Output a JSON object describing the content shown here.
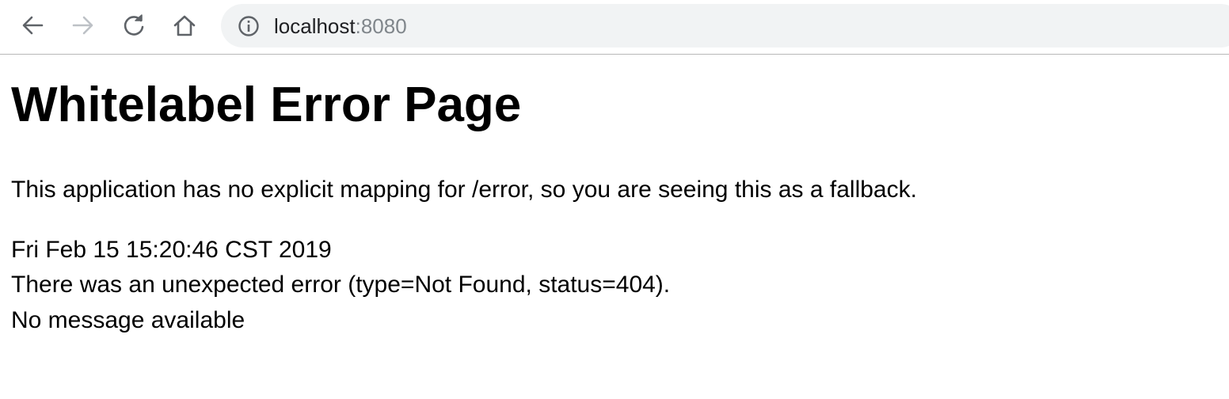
{
  "browser": {
    "address_bar": {
      "host": "localhost",
      "port": ":8080"
    },
    "icons": {
      "back": "arrow-left-icon",
      "forward": "arrow-right-icon",
      "reload": "reload-icon",
      "home": "home-icon",
      "site_info": "info-icon"
    },
    "forward_enabled": false
  },
  "page": {
    "heading": "Whitelabel Error Page",
    "fallback_message": "This application has no explicit mapping for /error, so you are seeing this as a fallback.",
    "timestamp": "Fri Feb 15 15:20:46 CST 2019",
    "error_line": "There was an unexpected error (type=Not Found, status=404).",
    "detail": "No message available"
  }
}
